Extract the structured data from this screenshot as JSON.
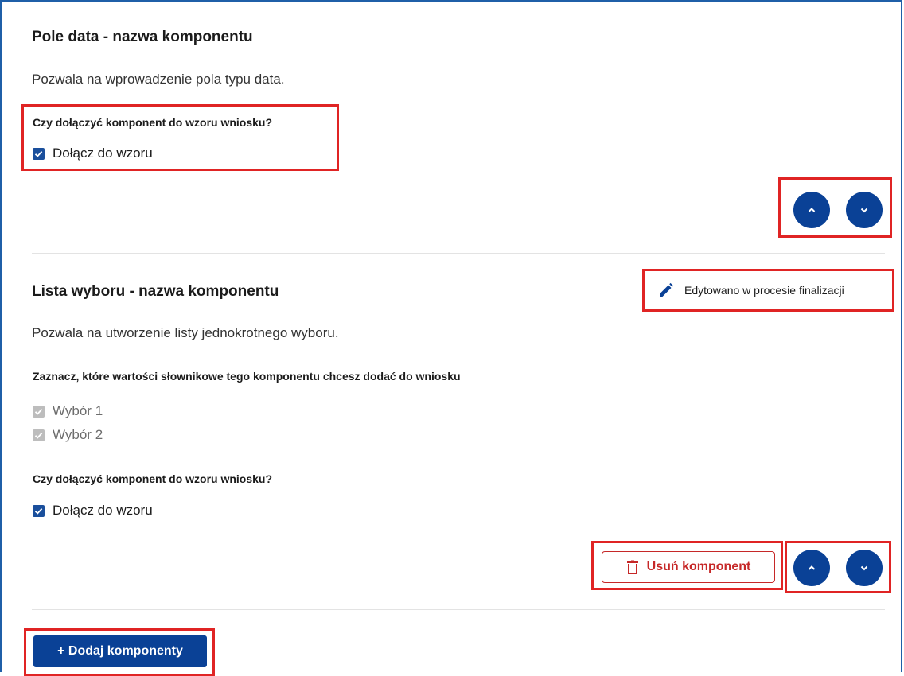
{
  "components": [
    {
      "title": "Pole data - nazwa komponentu",
      "description": "Pozwala na wprowadzenie pola typu data.",
      "include_question": "Czy dołączyć komponent do wzoru wniosku?",
      "include_label": "Dołącz do wzoru",
      "include_checked": true
    },
    {
      "title": "Lista wyboru - nazwa komponentu",
      "edited_badge": "Edytowano w procesie finalizacji",
      "description": "Pozwala na utworzenie listy jednokrotnego wyboru.",
      "dictionary_question": "Zaznacz, które wartości słownikowe tego komponentu chcesz dodać do wniosku",
      "options": [
        "Wybór 1",
        "Wybór 2"
      ],
      "include_question": "Czy dołączyć komponent do wzoru wniosku?",
      "include_label": "Dołącz do wzoru",
      "include_checked": true,
      "delete_label": "Usuń komponent"
    }
  ],
  "add_button_label": "+ Dodaj komponenty",
  "icons": {
    "move_up": "chevron-up-icon",
    "move_down": "chevron-down-icon",
    "edit": "pencil-icon",
    "delete": "trash-icon",
    "checkbox": "checkmark-icon"
  },
  "colors": {
    "primary": "#0a4196",
    "highlight": "#e02424",
    "danger": "#c62828",
    "frame": "#1f5fa8"
  }
}
